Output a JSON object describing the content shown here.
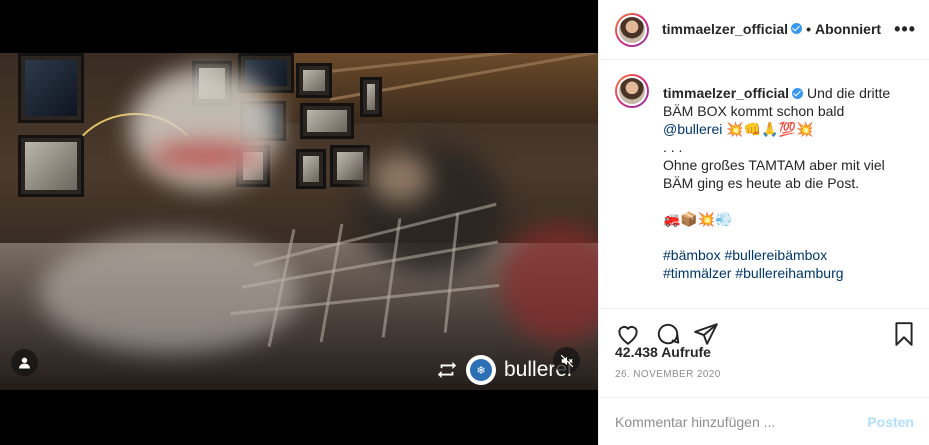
{
  "colors": {
    "accent": "#3897f0",
    "link": "#00376b",
    "muted": "#8e8e8e",
    "post_disabled": "#b2dffc"
  },
  "header": {
    "username": "timmaelzer_official",
    "dot": "•",
    "follow_status": "Abonniert",
    "more": "•••"
  },
  "caption": {
    "username": "timmaelzer_official",
    "line1": "Und die dritte BÄM BOX kommt schon bald",
    "mention": "@bullerei",
    "emojis1": "💥👊🙏💯💥",
    "dots": ". . .",
    "line2": "Ohne großes TAMTAM aber mit viel BÄM ging es heute ab die Post.",
    "emojis2": "🚒📦💥💨",
    "hashtags1": "#bämbox #bullereibämbox",
    "hashtags2": "#timmälzer #bullereihamburg"
  },
  "media": {
    "watermark_text": "bullerei",
    "repost_icon": "repost-icon",
    "user_icon": "user-icon",
    "mute_icon": "muted-speaker-icon"
  },
  "actions": {
    "views": "42.438 Aufrufe",
    "date": "26. NOVEMBER 2020"
  },
  "comment": {
    "placeholder": "Kommentar hinzufügen ...",
    "post_label": "Posten"
  }
}
